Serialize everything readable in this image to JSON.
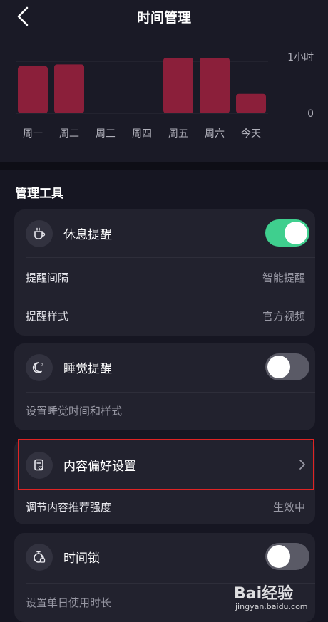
{
  "header": {
    "title": "时间管理"
  },
  "chart_data": {
    "type": "bar",
    "categories": [
      "周一",
      "周二",
      "周三",
      "周四",
      "周五",
      "周六",
      "今天"
    ],
    "values": [
      0.85,
      0.88,
      0,
      0,
      1.0,
      1.0,
      0.35
    ],
    "y_tick_labels": [
      "1小时",
      "0"
    ],
    "ylim": [
      0,
      1
    ],
    "bar_color": "#8b1f3a",
    "grid": true
  },
  "section": {
    "title": "管理工具"
  },
  "rest": {
    "label": "休息提醒",
    "enabled": true,
    "interval_label": "提醒间隔",
    "interval_value": "智能提醒",
    "style_label": "提醒样式",
    "style_value": "官方视频"
  },
  "sleep": {
    "label": "睡觉提醒",
    "enabled": false,
    "desc": "设置睡觉时间和样式"
  },
  "content": {
    "label": "内容偏好设置",
    "desc": "调节内容推荐强度",
    "value": "生效中"
  },
  "timelock": {
    "label": "时间锁",
    "enabled": false,
    "desc": "设置单日使用时长"
  },
  "watermark": {
    "brand": "Bai经验",
    "url": "jingyan.baidu.com"
  },
  "colors": {
    "toggle_on": "#3fcf8e",
    "highlight": "#e02424"
  }
}
